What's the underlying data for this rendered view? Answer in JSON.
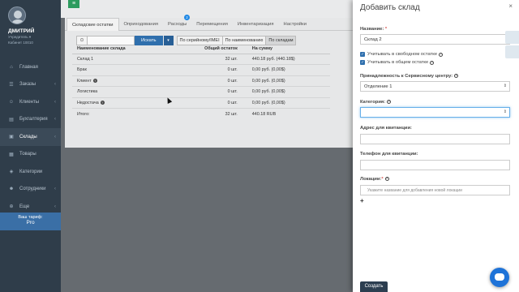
{
  "sidebar": {
    "user_name": "ДМИТРИЙ",
    "user_role_line1": "Учредитель ▾",
    "user_role_line2": "Кабинет 10010",
    "items": [
      {
        "label": "Главная",
        "icon": "home-icon",
        "glyph": "⌂",
        "has_arrow": false
      },
      {
        "label": "Заказы",
        "icon": "cart-icon",
        "glyph": "☰",
        "has_arrow": true
      },
      {
        "label": "Клиенты",
        "icon": "users-icon",
        "glyph": "☺",
        "has_arrow": true
      },
      {
        "label": "Бухгалтерия",
        "icon": "accounting-icon",
        "glyph": "▤",
        "has_arrow": true
      },
      {
        "label": "Склады",
        "icon": "warehouse-icon",
        "glyph": "▣",
        "has_arrow": true,
        "active": true
      },
      {
        "label": "Товары",
        "icon": "box-icon",
        "glyph": "▦",
        "has_arrow": false
      },
      {
        "label": "Категории",
        "icon": "tag-icon",
        "glyph": "◈",
        "has_arrow": false
      },
      {
        "label": "Сотрудники",
        "icon": "staff-icon",
        "glyph": "☻",
        "has_arrow": true
      },
      {
        "label": "Еще",
        "icon": "more-icon",
        "glyph": "⊕",
        "has_arrow": true
      }
    ],
    "tariff_line1": "Ваш тариф:",
    "tariff_line2": "Pro"
  },
  "tabs": [
    {
      "label": "Складские остатки",
      "active": true
    },
    {
      "label": "Оприходования"
    },
    {
      "label": "Расходы",
      "badge": "2"
    },
    {
      "label": "Перемещения"
    },
    {
      "label": "Инвентаризация"
    },
    {
      "label": "Настройки"
    }
  ],
  "search": {
    "button_label": "Искать",
    "filter_serial": "По серийному/IMEI",
    "filter_name": "По наименованию",
    "filter_warehouse": "По складам"
  },
  "table": {
    "headers": [
      "Наименование склада",
      "Общий остаток",
      "На сумму"
    ],
    "rows": [
      {
        "name": "Склад 1",
        "qty": "32 шт.",
        "sum": "440.18 руб. (440.18$)",
        "help": false
      },
      {
        "name": "Брак",
        "qty": "0 шт.",
        "sum": "0,00 руб. (0,00$)",
        "help": false
      },
      {
        "name": "Клиент",
        "qty": "0 шт.",
        "sum": "0,00 руб. (0,00$)",
        "help": true
      },
      {
        "name": "Логистика",
        "qty": "0 шт.",
        "sum": "0,00 руб. (0,00$)",
        "help": false
      },
      {
        "name": "Недостача",
        "qty": "0 шт.",
        "sum": "0,00 руб. (0,00$)",
        "help": true
      }
    ],
    "total_label": "Итого:",
    "total_qty": "32 шт.",
    "total_sum": "440.18 RUB"
  },
  "drawer": {
    "title": "Добавить склад",
    "name_label": "Название:",
    "name_value": "Склад 2",
    "check1": "Учитывать в свободном остатке",
    "check2": "Учитывать в общем остатке",
    "service_label": "Принадлежность к Сервисному центру:",
    "service_value": "Отделение 1",
    "category_label": "Категория:",
    "category_value": "",
    "address_label": "Адрес для квитанции:",
    "phone_label": "Телефон для квитанции:",
    "locations_label": "Локации:",
    "locations_placeholder": "Укажите название для добавления новой локации",
    "create_button": "Создать"
  }
}
